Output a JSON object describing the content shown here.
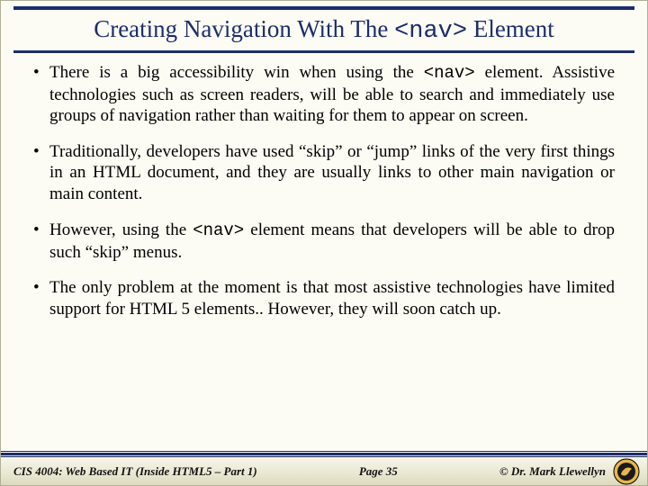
{
  "title": {
    "prefix": "Creating Navigation With The ",
    "code": "<nav>",
    "suffix": " Element"
  },
  "bullets": [
    {
      "pre": "There is a big accessibility win when using the ",
      "code": "<nav>",
      "post": " element. Assistive technologies such as screen readers, will be able to search and immediately use groups of navigation rather than waiting for them to appear on screen."
    },
    {
      "pre": "Traditionally, developers have used “skip” or “jump” links of the very first things in an HTML document, and they are usually links to other main navigation or main content.",
      "code": "",
      "post": ""
    },
    {
      "pre": "However, using the ",
      "code": "<nav>",
      "post": " element means that developers will be able to drop such “skip” menus."
    },
    {
      "pre": "The only problem at the moment is that most assistive technologies have limited support for HTML 5 elements.. However, they will soon catch up.",
      "code": "",
      "post": ""
    }
  ],
  "footer": {
    "course": "CIS 4004: Web Based IT (Inside HTML5 – Part 1)",
    "page": "Page 35",
    "author": "© Dr. Mark Llewellyn"
  }
}
